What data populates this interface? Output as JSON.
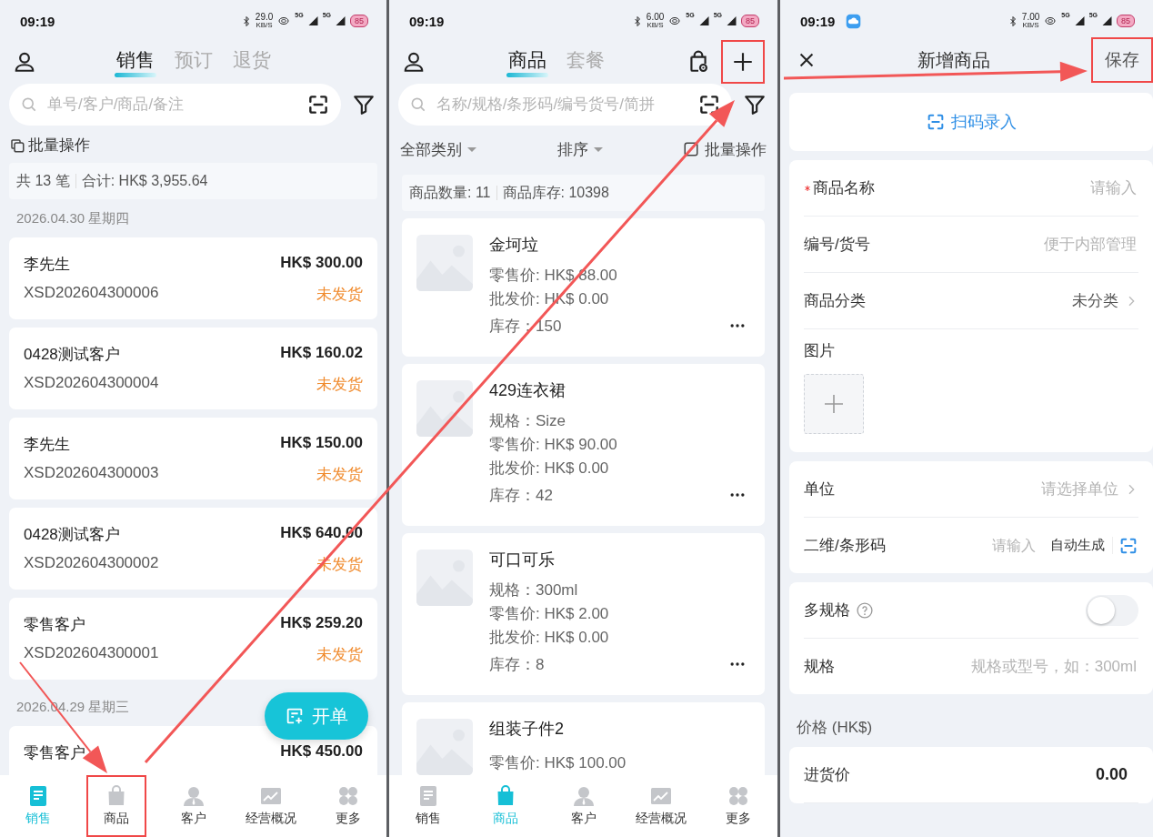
{
  "screens": [
    {
      "kind": "sales",
      "status_bar": {
        "time": "09:19",
        "notification_icon": false,
        "speed": "29.0",
        "speed_unit": "KB/S",
        "network": [
          "5G",
          "5G"
        ],
        "battery": "85"
      },
      "tabs": [
        {
          "label": "销售",
          "selected": true
        },
        {
          "label": "预订",
          "selected": false
        },
        {
          "label": "退货",
          "selected": false
        }
      ],
      "search": {
        "placeholder": "单号/客户/商品/备注"
      },
      "batch_action": "批量操作",
      "summary": [
        "共 13 笔",
        "合计: HK$ 3,955.64"
      ],
      "groups": [
        {
          "date": "2026.04.30 星期四",
          "orders": [
            {
              "customer": "李先生",
              "amount": "HK$ 300.00",
              "number": "XSD202604300006",
              "status": "未发货"
            },
            {
              "customer": "0428测试客户",
              "amount": "HK$ 160.02",
              "number": "XSD202604300004",
              "status": "未发货"
            },
            {
              "customer": "李先生",
              "amount": "HK$ 150.00",
              "number": "XSD202604300003",
              "status": "未发货"
            },
            {
              "customer": "0428测试客户",
              "amount": "HK$ 640.00",
              "number": "XSD202604300002",
              "status": "未发货"
            },
            {
              "customer": "零售客户",
              "amount": "HK$ 259.20",
              "number": "XSD202604300001",
              "status": "未发货"
            }
          ]
        },
        {
          "date": "2026.04.29 星期三",
          "orders": [
            {
              "customer": "零售客户",
              "amount": "HK$ 450.00"
            }
          ]
        }
      ],
      "fab": "开单",
      "nav": [
        {
          "label": "销售",
          "selected": true,
          "highlighted": false
        },
        {
          "label": "商品",
          "selected": false,
          "highlighted": true
        },
        {
          "label": "客户",
          "selected": false,
          "highlighted": false
        },
        {
          "label": "经营概况",
          "selected": false,
          "highlighted": false
        },
        {
          "label": "更多",
          "selected": false,
          "highlighted": false
        }
      ]
    },
    {
      "kind": "products",
      "status_bar": {
        "time": "09:19",
        "notification_icon": false,
        "speed": "6.00",
        "speed_unit": "KB/S",
        "network": [
          "5G",
          "5G"
        ],
        "battery": "85"
      },
      "tabs": [
        {
          "label": "商品",
          "selected": true
        },
        {
          "label": "套餐",
          "selected": false
        }
      ],
      "add_button": {
        "highlighted": true
      },
      "search": {
        "placeholder": "名称/规格/条形码/编号货号/简拼"
      },
      "toolbar": {
        "category": "全部类别",
        "sort": "排序",
        "batch_action": "批量操作"
      },
      "summary": [
        "商品数量: 11",
        "商品库存: 10398"
      ],
      "products": [
        {
          "name": "金坷垃",
          "lines": [
            "零售价: HK$ 88.00",
            "批发价: HK$ 0.00",
            "库存：150"
          ]
        },
        {
          "name": "429连衣裙",
          "lines": [
            "规格：Size",
            "零售价: HK$ 90.00",
            "批发价: HK$ 0.00",
            "库存：42"
          ]
        },
        {
          "name": "可口可乐",
          "lines": [
            "规格：300ml",
            "零售价: HK$ 2.00",
            "批发价: HK$ 0.00",
            "库存：8"
          ]
        },
        {
          "name": "组装子件2",
          "lines": [
            "零售价: HK$ 100.00"
          ]
        }
      ],
      "nav": [
        {
          "label": "销售",
          "selected": false,
          "highlighted": false
        },
        {
          "label": "商品",
          "selected": true,
          "highlighted": false
        },
        {
          "label": "客户",
          "selected": false,
          "highlighted": false
        },
        {
          "label": "经营概况",
          "selected": false,
          "highlighted": false
        },
        {
          "label": "更多",
          "selected": false,
          "highlighted": false
        }
      ]
    },
    {
      "kind": "form",
      "status_bar": {
        "time": "09:19",
        "notification_icon": true,
        "speed": "7.00",
        "speed_unit": "KB/S",
        "network": [
          "5G",
          "5G"
        ],
        "battery": "85"
      },
      "title": "新增商品",
      "save": {
        "label": "保存",
        "highlighted": true
      },
      "scan_entry": "扫码录入",
      "sections": [
        {
          "rows": [
            {
              "kind": "input",
              "label": "商品名称",
              "required": true,
              "placeholder": "请输入"
            },
            {
              "kind": "input",
              "label": "编号/货号",
              "required": false,
              "placeholder": "便于内部管理"
            },
            {
              "kind": "select",
              "label": "商品分类",
              "value": "未分类"
            },
            {
              "kind": "image",
              "label": "图片"
            }
          ]
        },
        {
          "rows": [
            {
              "kind": "select",
              "label": "单位",
              "placeholder": "请选择单位"
            },
            {
              "kind": "code",
              "label": "二维/条形码",
              "placeholder": "请输入",
              "action": "自动生成"
            }
          ]
        },
        {
          "rows": [
            {
              "kind": "toggle",
              "label": "多规格",
              "on": false
            },
            {
              "kind": "input",
              "label": "规格",
              "required": false,
              "placeholder": "规格或型号，如：300ml"
            }
          ]
        },
        {
          "header": "价格 (HK$)",
          "rows": [
            {
              "kind": "value",
              "label": "进货价",
              "value": "0.00"
            }
          ]
        }
      ]
    }
  ]
}
